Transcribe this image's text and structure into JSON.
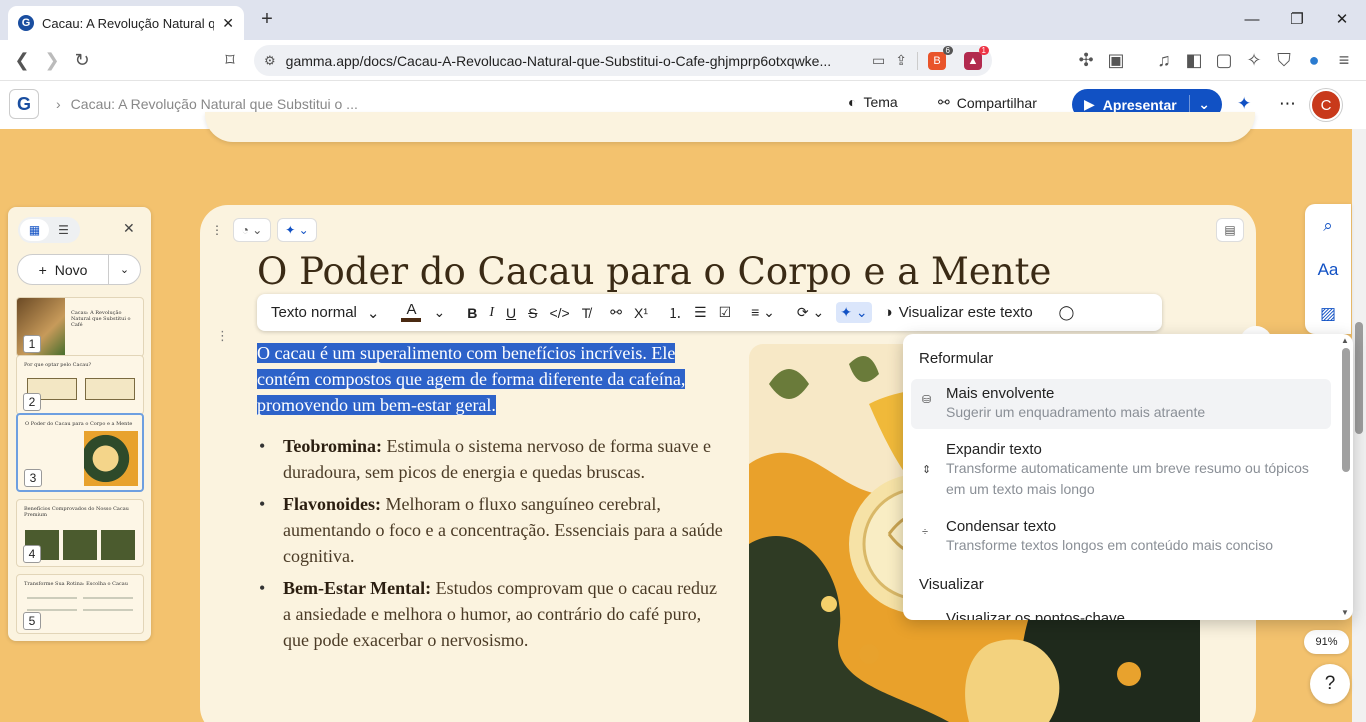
{
  "browser": {
    "tab_title": "Cacau: A Revolução Natural que",
    "url": "gamma.app/docs/Cacau-A-Revolucao-Natural-que-Substitui-o-Cafe-ghjmprp6otxqwke...",
    "brave_count": "6",
    "alert_count": "1"
  },
  "app": {
    "breadcrumb": "Cacau: A Revolução Natural que Substitui o ...",
    "theme_label": "Tema",
    "share_label": "Compartilhar",
    "present_label": "Apresentar",
    "avatar_initial": "C",
    "accent": "#1151c4"
  },
  "sidebar": {
    "new_label": "Novo",
    "slides": [
      {
        "num": "1",
        "title": "Cacau: A Revolução Natural que Substitui o Café"
      },
      {
        "num": "2",
        "title": "Por que optar pelo Cacau?"
      },
      {
        "num": "3",
        "title": "O Poder do Cacau para o Corpo e a Mente"
      },
      {
        "num": "4",
        "title": "Benefícios Comprovados do Nosso Cacau Premium"
      },
      {
        "num": "5",
        "title": "Transforme Sua Rotina: Escolha o Cacau"
      }
    ]
  },
  "card": {
    "heading": "O Poder do Cacau para o Corpo e a Mente",
    "intro": "O cacau é um superalimento com benefícios incríveis. Ele contém compostos que agem de forma diferente da cafeína, promovendo um bem-estar geral.",
    "bullets": [
      {
        "label": "Teobromina:",
        "text": " Estimula o sistema nervoso de forma suave e duradoura, sem picos de energia e quedas bruscas."
      },
      {
        "label": "Flavonoides:",
        "text": " Melhoram o fluxo sanguíneo cerebral, aumentando o foco e a concentração. Essenciais para a saúde cognitiva."
      },
      {
        "label": "Bem-Estar Mental:",
        "text": " Estudos comprovam que o cacau reduz a ansiedade e melhora o humor, ao contrário do café puro, que pode exacerbar o nervosismo."
      }
    ]
  },
  "toolbar": {
    "style_label": "Texto normal",
    "visualize_label": "Visualizar este texto"
  },
  "ai_menu": {
    "section1": "Reformular",
    "items": [
      {
        "title": "Mais envolvente",
        "desc": "Sugerir um enquadramento mais atraente"
      },
      {
        "title": "Expandir texto",
        "desc": "Transforme automaticamente um breve resumo ou tópicos em um texto mais longo"
      },
      {
        "title": "Condensar texto",
        "desc": "Transforme textos longos em conteúdo mais conciso"
      }
    ],
    "section2": "Visualizar",
    "partial_item": "Visualizar os pontos-chave"
  },
  "zoom": "91%",
  "help": "?"
}
